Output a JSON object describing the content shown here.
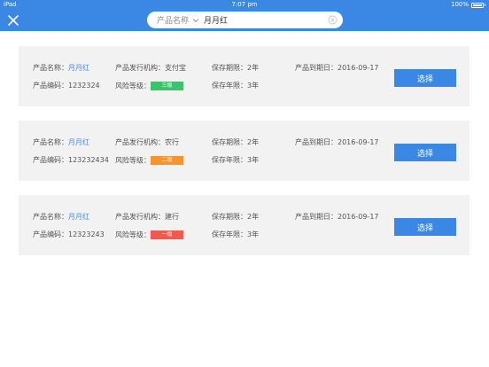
{
  "status_bar": {
    "device": "iPad",
    "time": "7:07 pm",
    "battery": "100%"
  },
  "search": {
    "category": "产品名称",
    "value": "月月红"
  },
  "products": [
    {
      "name_label": "产品名称：",
      "name": "月月红",
      "code_label": "产品编码：",
      "code": "1232324",
      "issuer_label": "产品发行机构：",
      "issuer": "支付宝",
      "risk_label": "风险等级：",
      "risk": "三级",
      "risk_color": "#3cc36b",
      "period_label": "保存期限：",
      "period": "2年",
      "years_label": "保存年限：",
      "years": "3年",
      "expiry_label": "产品到期日：",
      "expiry": "2016-09-17",
      "button": "选择"
    },
    {
      "name_label": "产品名称：",
      "name": "月月红",
      "code_label": "产品编码：",
      "code": "123232434",
      "issuer_label": "产品发行机构：",
      "issuer": "农行",
      "risk_label": "风险等级：",
      "risk": "二级",
      "risk_color": "#f5952f",
      "period_label": "保存期限：",
      "period": "2年",
      "years_label": "保存年限：",
      "years": "3年",
      "expiry_label": "产品到期日：",
      "expiry": "2016-09-17",
      "button": "选择"
    },
    {
      "name_label": "产品名称：",
      "name": "月月红",
      "code_label": "产品编码：",
      "code": "12323243",
      "issuer_label": "产品发行机构：",
      "issuer": "建行",
      "risk_label": "风险等级：",
      "risk": "一级",
      "risk_color": "#ee5a52",
      "period_label": "保存期限：",
      "period": "2年",
      "years_label": "保存年限：",
      "years": "3年",
      "expiry_label": "产品到期日：",
      "expiry": "2016-09-17",
      "button": "选择"
    }
  ]
}
